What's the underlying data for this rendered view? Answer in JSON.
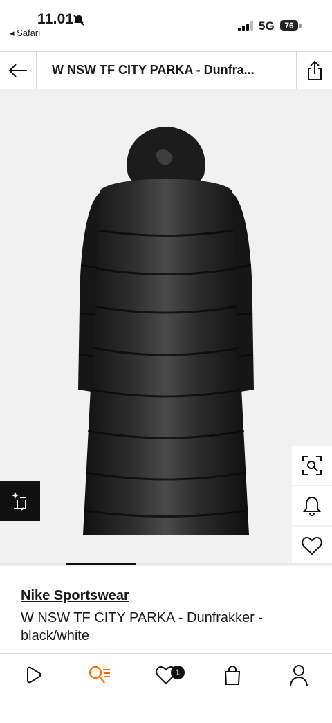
{
  "status_bar": {
    "time": "11.01",
    "back_app": "◂ Safari",
    "network": "5G",
    "battery": "76"
  },
  "nav": {
    "title": "W NSW TF CITY PARKA - Dunfra..."
  },
  "product": {
    "brand": "Nike Sportswear",
    "name": "W NSW TF CITY PARKA - Dunfrakker - black/white",
    "image_position": 0.2
  },
  "tabbar": {
    "wishlist_count": "1"
  },
  "icons": {
    "back": "arrow-left-icon",
    "share": "share-icon",
    "visual_search": "visual-search-icon",
    "alert": "bell-icon",
    "wishlist": "heart-icon",
    "ai_outfit": "sparkle-crop-icon",
    "tabs": [
      "play-icon",
      "search-icon",
      "heart-icon",
      "bag-icon",
      "profile-icon"
    ]
  },
  "colors": {
    "accent": "#ff6900",
    "primary": "#1a1a1a"
  }
}
